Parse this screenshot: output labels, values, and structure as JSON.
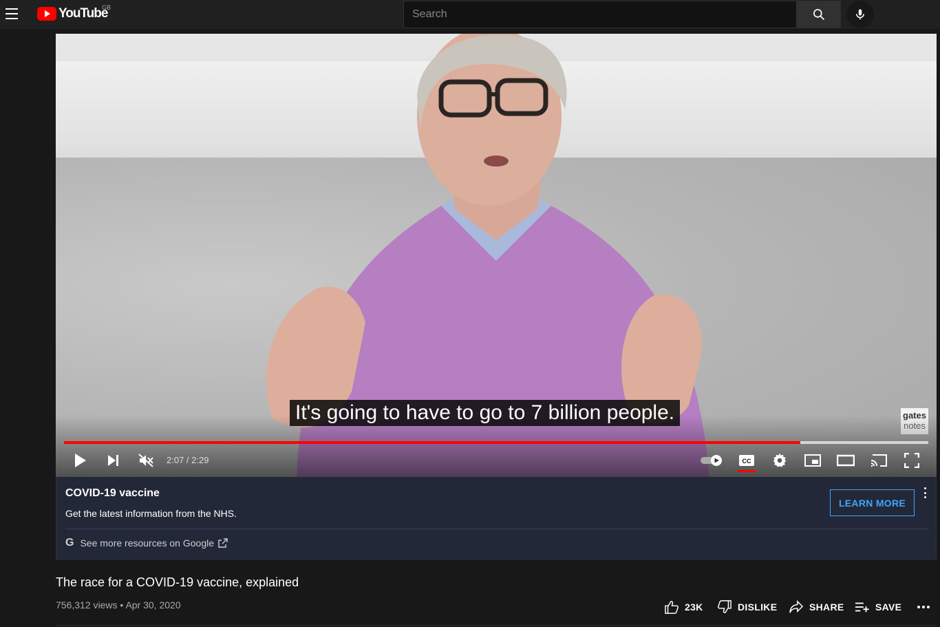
{
  "header": {
    "logo_text": "YouTube",
    "region": "GB",
    "search_placeholder": "Search",
    "icons": [
      "menu-icon",
      "search-icon",
      "mic-icon"
    ]
  },
  "player": {
    "subtitle": "It's going to have to go to 7 billion people.",
    "watermark_line1": "gates",
    "watermark_line2": "notes",
    "time": "2:07 / 2:29",
    "progress_fraction": 0.852,
    "buffer_fraction": 1.0,
    "autoplay_on": true,
    "icons": [
      "play-icon",
      "next-icon",
      "muted-volume-icon",
      "autoplay-toggle-icon",
      "cc-icon",
      "settings-icon",
      "miniplayer-icon",
      "theater-icon",
      "cast-icon",
      "fullscreen-icon"
    ],
    "accent": "#ff0000"
  },
  "info_panel": {
    "title": "COVID-19 vaccine",
    "description": "Get the latest information from the NHS.",
    "button": "LEARN MORE",
    "google_link": "See more resources on Google",
    "accent": "#3ea6ff"
  },
  "video": {
    "title": "The race for a COVID-19 vaccine, explained",
    "views": "756,312 views",
    "date": "Apr 30, 2020",
    "actions": {
      "like": "23K",
      "dislike": "DISLIKE",
      "share": "SHARE",
      "save": "SAVE"
    }
  }
}
